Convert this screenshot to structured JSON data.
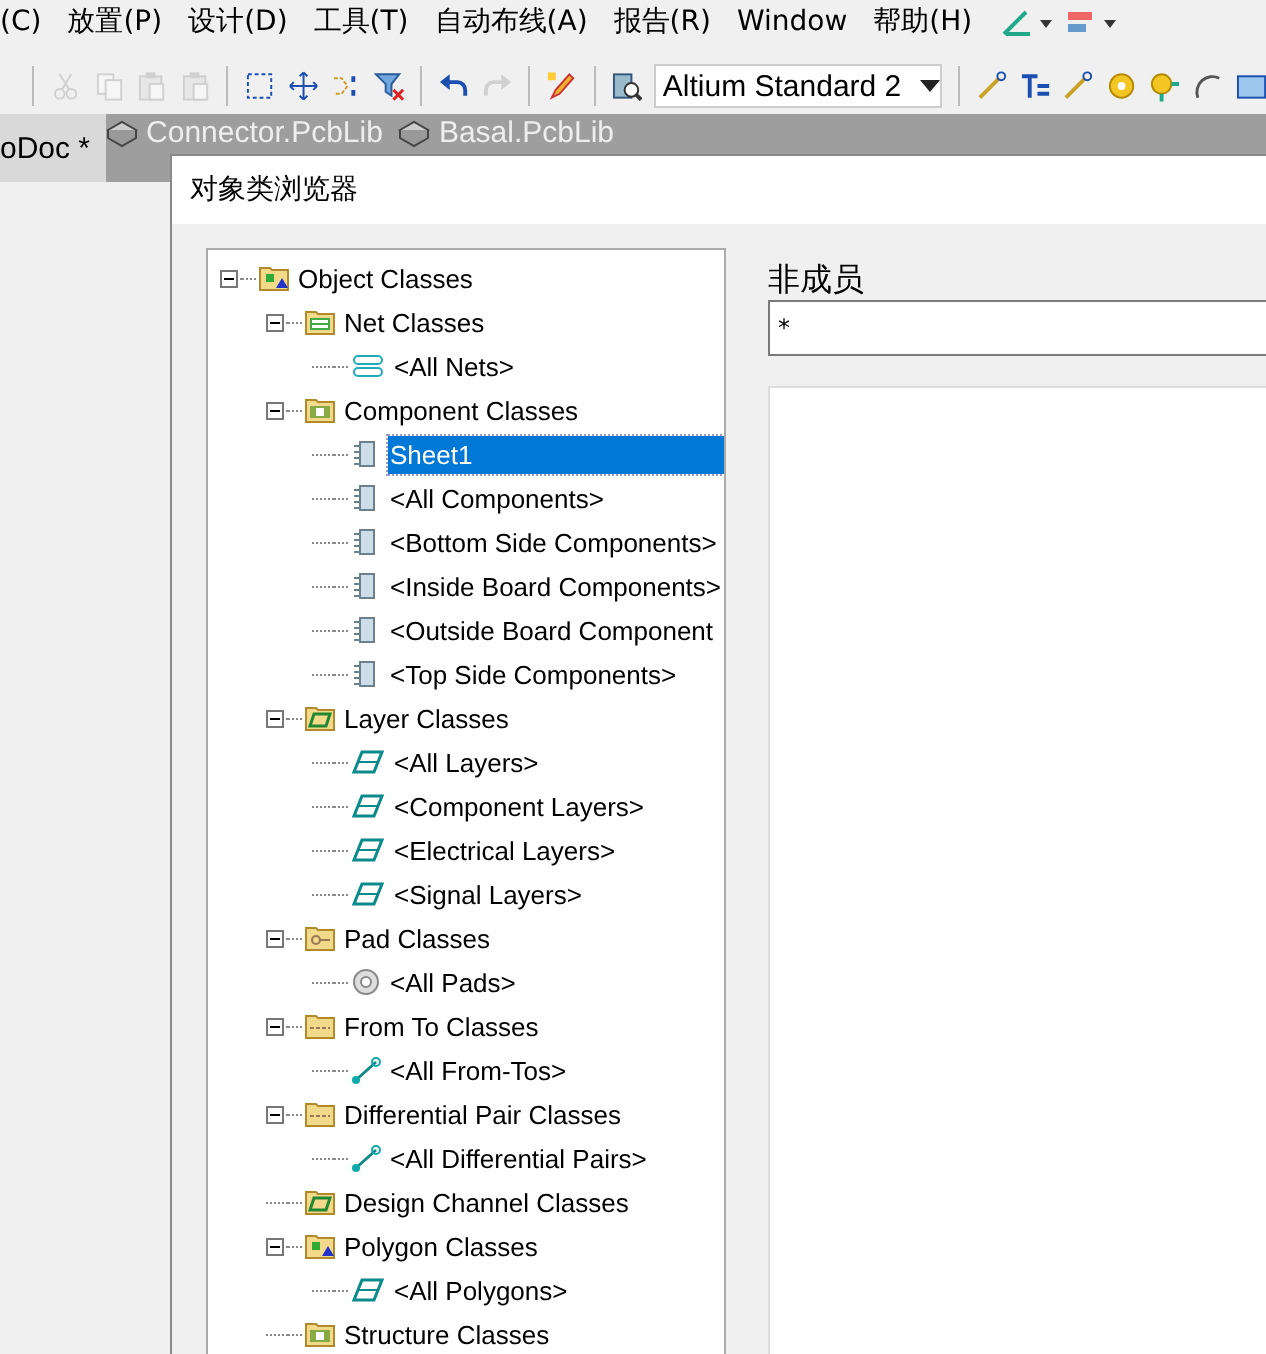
{
  "menu": [
    "(C)",
    "放置(P)",
    "设计(D)",
    "工具(T)",
    "自动布线(A)",
    "报告(R)",
    "Window",
    "帮助(H)"
  ],
  "toolbar": {
    "buttons": [
      {
        "kind": "cut",
        "disabled": true
      },
      {
        "kind": "copy",
        "disabled": true
      },
      {
        "kind": "paste",
        "disabled": true
      },
      {
        "kind": "paste",
        "disabled": true
      },
      {
        "kind": "select",
        "disabled": false
      },
      {
        "kind": "move",
        "disabled": false
      },
      {
        "kind": "cross",
        "disabled": false
      },
      {
        "kind": "filter",
        "disabled": false
      },
      {
        "kind": "undo",
        "disabled": false
      },
      {
        "kind": "redo",
        "disabled": true
      },
      {
        "kind": "pencil",
        "disabled": false
      },
      {
        "kind": "inspect",
        "disabled": false
      }
    ],
    "combo": "Altium Standard 2",
    "tools": [
      {
        "kind": "route"
      },
      {
        "kind": "fanout"
      },
      {
        "kind": "route"
      },
      {
        "kind": "pad"
      },
      {
        "kind": "via"
      },
      {
        "kind": "arc"
      },
      {
        "kind": "rect"
      }
    ]
  },
  "doc_tabs": [
    {
      "label": "oDoc *",
      "selected": true
    },
    {
      "label": "Connector.PcbLib",
      "selected": false
    },
    {
      "label": "Basal.PcbLib",
      "selected": false
    }
  ],
  "dialog": {
    "title": "对象类浏览器",
    "tree": [
      {
        "label": "Object Classes",
        "kind": "root",
        "expanded": true,
        "selected": false,
        "children": [
          {
            "label": "Net Classes",
            "kind": "net-class",
            "expanded": true,
            "selected": false,
            "children": [
              {
                "label": "<All Nets>",
                "kind": "net",
                "selected": false
              }
            ]
          },
          {
            "label": "Component Classes",
            "kind": "component-class",
            "expanded": true,
            "selected": false,
            "children": [
              {
                "label": "Sheet1",
                "kind": "component",
                "selected": true
              },
              {
                "label": "<All Components>",
                "kind": "component",
                "selected": false
              },
              {
                "label": "<Bottom Side Components>",
                "kind": "component",
                "selected": false
              },
              {
                "label": "<Inside Board Components>",
                "kind": "component",
                "selected": false
              },
              {
                "label": "<Outside Board Component",
                "kind": "component",
                "selected": false
              },
              {
                "label": "<Top Side Components>",
                "kind": "component",
                "selected": false
              }
            ]
          },
          {
            "label": "Layer Classes",
            "kind": "layer-class",
            "expanded": true,
            "selected": false,
            "children": [
              {
                "label": "<All Layers>",
                "kind": "layer",
                "selected": false
              },
              {
                "label": "<Component Layers>",
                "kind": "layer",
                "selected": false
              },
              {
                "label": "<Electrical Layers>",
                "kind": "layer",
                "selected": false
              },
              {
                "label": "<Signal Layers>",
                "kind": "layer",
                "selected": false
              }
            ]
          },
          {
            "label": "Pad Classes",
            "kind": "pad-class",
            "expanded": true,
            "selected": false,
            "children": [
              {
                "label": "<All Pads>",
                "kind": "pad",
                "selected": false
              }
            ]
          },
          {
            "label": "From To Classes",
            "kind": "fromto-class",
            "expanded": true,
            "selected": false,
            "children": [
              {
                "label": "<All From-Tos>",
                "kind": "fromto",
                "selected": false
              }
            ]
          },
          {
            "label": "Differential Pair Classes",
            "kind": "fromto-class",
            "expanded": true,
            "selected": false,
            "children": [
              {
                "label": "<All Differential Pairs>",
                "kind": "fromto",
                "selected": false
              }
            ]
          },
          {
            "label": "Design Channel Classes",
            "kind": "layer-class",
            "selected": false
          },
          {
            "label": "Polygon Classes",
            "kind": "root",
            "expanded": true,
            "selected": false,
            "children": [
              {
                "label": "<All Polygons>",
                "kind": "layer",
                "selected": false
              }
            ]
          },
          {
            "label": "Structure Classes",
            "kind": "component-class",
            "selected": false
          }
        ]
      }
    ],
    "non_members_label": "非成员",
    "filter_value": "*"
  }
}
